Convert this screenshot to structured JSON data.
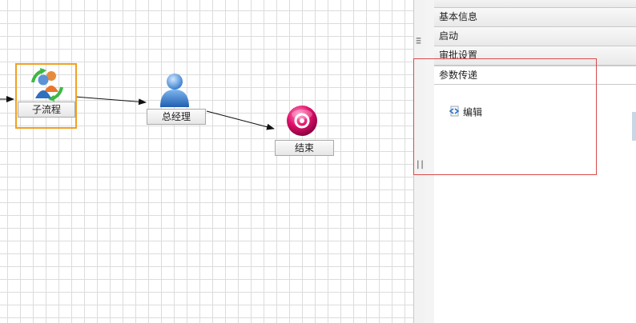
{
  "flow": {
    "nodes": {
      "subprocess": {
        "label": "子流程",
        "icon": "subprocess-users-icon"
      },
      "general_manager": {
        "label": "总经理",
        "icon": "user-icon"
      },
      "end": {
        "label": "结束",
        "icon": "end-node-icon"
      }
    },
    "colors": {
      "selection": "#f0a020",
      "grid": "#dcdcdc",
      "edge": "#111111",
      "end_node": "#e0106a"
    }
  },
  "properties_panel": {
    "sections": [
      {
        "label": "基本信息"
      },
      {
        "label": "启动"
      },
      {
        "label": "审批设置"
      },
      {
        "label": "参数传递"
      }
    ],
    "active_section": {
      "items": [
        {
          "label": "编辑",
          "icon": "edit-icon"
        }
      ]
    },
    "highlight_color": "#d84a4a"
  }
}
